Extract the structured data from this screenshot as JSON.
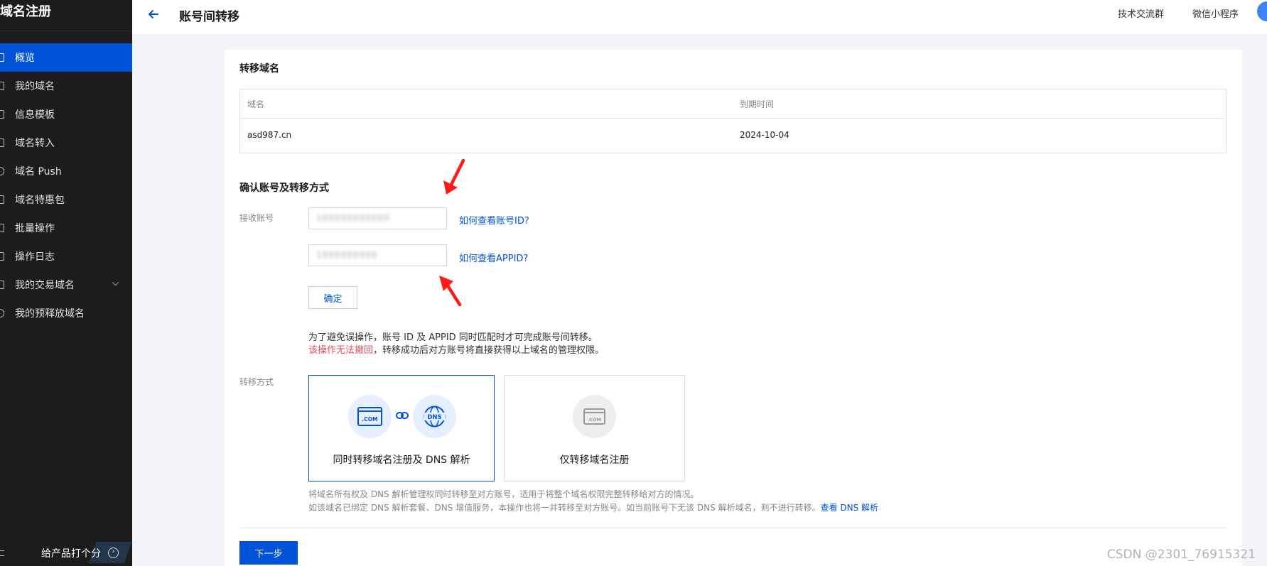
{
  "sidebar": {
    "title": "域名注册",
    "items": [
      {
        "label": "概览",
        "active": true
      },
      {
        "label": "我的域名"
      },
      {
        "label": "信息模板"
      },
      {
        "label": "域名转入"
      },
      {
        "label": "域名 Push"
      },
      {
        "label": "域名特惠包"
      },
      {
        "label": "批量操作"
      },
      {
        "label": "操作日志"
      },
      {
        "label": "我的交易域名",
        "has_chevron": true
      },
      {
        "label": "我的预释放域名"
      }
    ],
    "footer_label": "给产品打个分"
  },
  "header": {
    "title": "账号间转移",
    "links": [
      "技术交流群",
      "微信小程序"
    ]
  },
  "transfer_domains": {
    "heading": "转移域名",
    "columns": [
      "域名",
      "到期时间"
    ],
    "rows": [
      [
        "asd987.cn",
        "2024-10-04"
      ]
    ]
  },
  "confirm": {
    "heading": "确认账号及转移方式",
    "account_label": "接收账号",
    "account_id_value": "100000000000",
    "appid_value": "1000000000",
    "account_help": "如何查看账号ID?",
    "appid_help": "如何查看APPID?",
    "confirm_button": "确定",
    "note_line1": "为了避免误操作，账号 ID 及 APPID 同时匹配时才可完成账号间转移。",
    "note_line2_red": "该操作无法撤回",
    "note_line2_rest": "，转移成功后对方账号将直接获得以上域名的管理权限。"
  },
  "method": {
    "label": "转移方式",
    "options": [
      {
        "label": "同时转移域名注册及 DNS 解析",
        "selected": true
      },
      {
        "label": "仅转移域名注册",
        "selected": false
      }
    ],
    "desc_line1": "将域名所有权及 DNS 解析管理权同时转移至对方账号，适用于将整个域名权限完整转移给对方的情况。",
    "desc_line2": "如该域名已绑定 DNS 解析套餐、DNS 增值服务，本操作也将一并转移至对方账号。如当前账号下无该 DNS 解析域名，则不进行转移。",
    "desc_link": "查看 DNS 解析"
  },
  "next_button": "下一步",
  "watermark": "CSDN @2301_76915321",
  "colors": {
    "primary": "#0052d9",
    "sidebar_bg": "#1c1c1c",
    "danger": "#e34d59",
    "annotation": "#ff1a1a"
  }
}
